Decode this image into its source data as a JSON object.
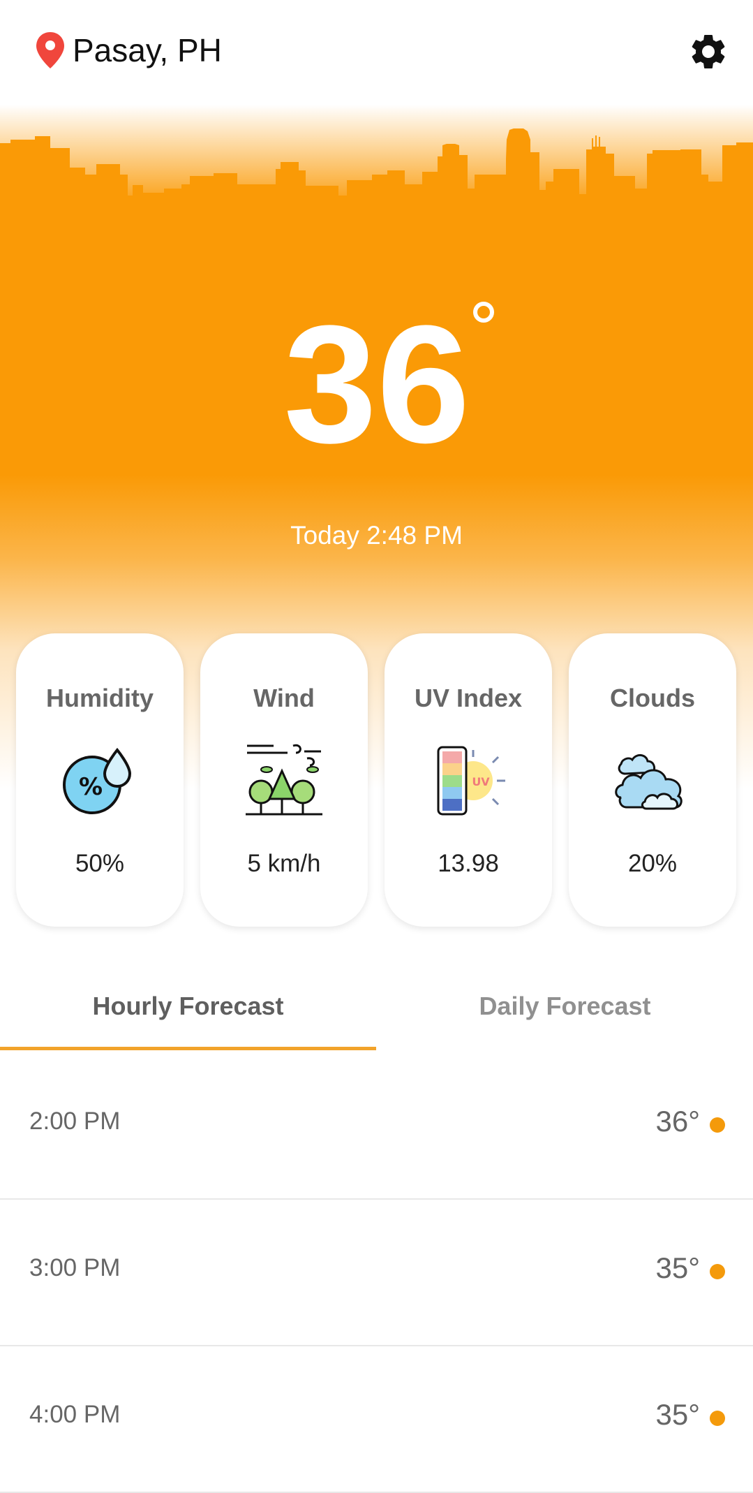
{
  "header": {
    "location": "Pasay, PH",
    "location_icon": "map-pin-icon",
    "settings_icon": "gear-icon"
  },
  "current": {
    "temperature": "36",
    "updated": "Today 2:48 PM"
  },
  "metrics": [
    {
      "title": "Humidity",
      "value": "50%",
      "icon": "humidity-icon"
    },
    {
      "title": "Wind",
      "value": "5 km/h",
      "icon": "wind-icon"
    },
    {
      "title": "UV Index",
      "value": "13.98",
      "icon": "uv-index-icon"
    },
    {
      "title": "Clouds",
      "value": "20%",
      "icon": "clouds-icon"
    }
  ],
  "tabs": {
    "hourly": "Hourly Forecast",
    "daily": "Daily Forecast",
    "active": "hourly"
  },
  "hourly": [
    {
      "time": "2:00 PM",
      "temp": "36°"
    },
    {
      "time": "3:00 PM",
      "temp": "35°"
    },
    {
      "time": "4:00 PM",
      "temp": "35°"
    }
  ],
  "colors": {
    "accent": "#fa9a06",
    "tab_underline": "#f2a32a",
    "pin": "#f0463c",
    "dot": "#f49a0b"
  }
}
